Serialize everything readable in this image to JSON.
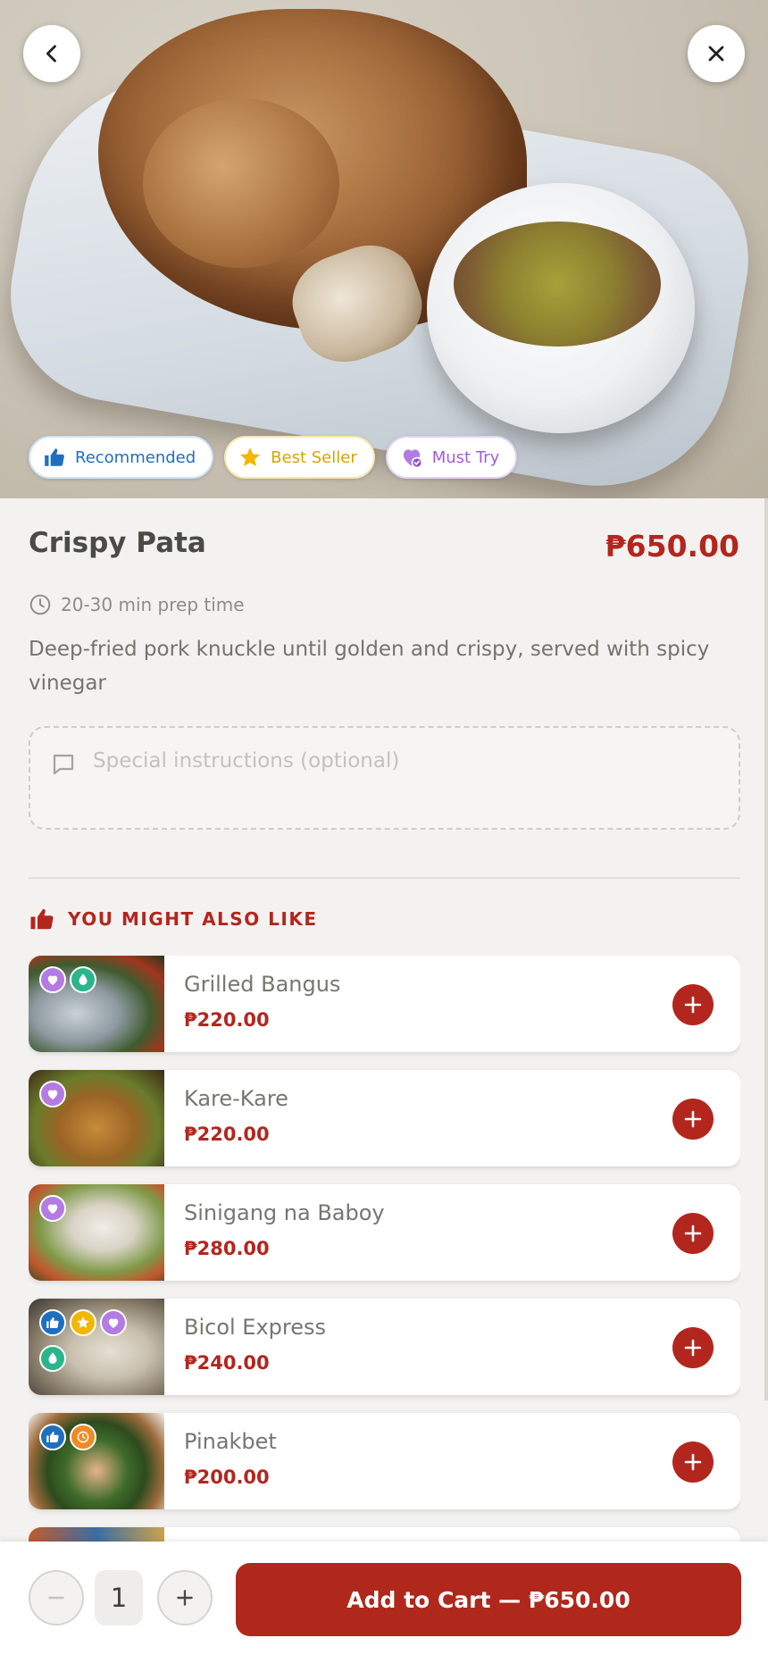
{
  "badges": [
    {
      "label": "Recommended",
      "icon": "thumbs-up-icon",
      "color": "#1f6fbf"
    },
    {
      "label": "Best Seller",
      "icon": "star-icon",
      "color": "#f2b705"
    },
    {
      "label": "Must Try",
      "icon": "heart-check-icon",
      "color": "#a35bd6"
    }
  ],
  "item": {
    "name": "Crispy Pata",
    "price": "₱650.00",
    "prep_time": "20-30 min prep time",
    "description": "Deep-fried pork knuckle until golden and crispy, served with spicy vinegar"
  },
  "instructions": {
    "placeholder": "Special instructions (optional)",
    "value": ""
  },
  "section": {
    "title": "YOU MIGHT ALSO LIKE",
    "icon": "thumbs-up-icon"
  },
  "suggestions": [
    {
      "name": "Grilled Bangus",
      "price": "₱220.00",
      "tags": [
        "must-try",
        "spicy"
      ]
    },
    {
      "name": "Kare-Kare",
      "price": "₱220.00",
      "tags": [
        "must-try"
      ]
    },
    {
      "name": "Sinigang na Baboy",
      "price": "₱280.00",
      "tags": [
        "must-try"
      ]
    },
    {
      "name": "Bicol Express",
      "price": "₱240.00",
      "tags": [
        "recommended",
        "best-seller",
        "must-try",
        "spicy"
      ]
    },
    {
      "name": "Pinakbet",
      "price": "₱200.00",
      "tags": [
        "recommended",
        "quick"
      ]
    },
    {
      "name": "",
      "price": "",
      "tags": []
    }
  ],
  "cart": {
    "quantity": "1",
    "button_label": "Add to Cart — ₱650.00"
  },
  "colors": {
    "accent": "#b3261e",
    "recommended": "#1f6fbf",
    "best_seller": "#f2b705",
    "must_try": "#a35bd6",
    "spicy": "#2bb58a",
    "quick": "#f08a24"
  }
}
